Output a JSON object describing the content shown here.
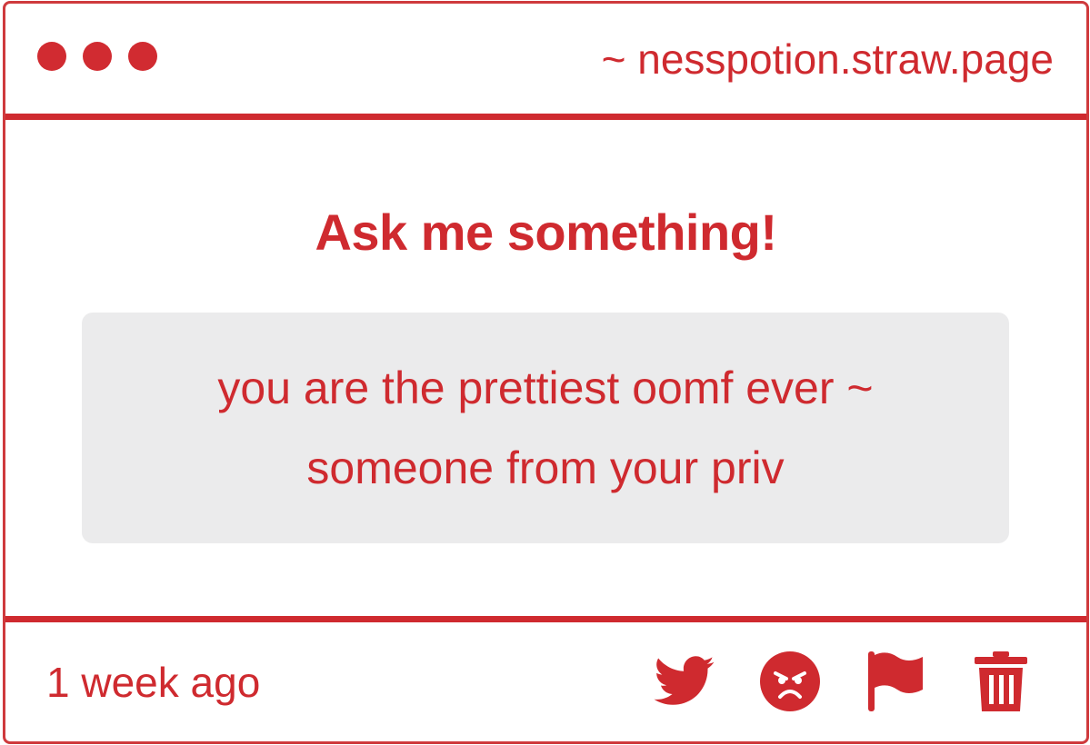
{
  "window": {
    "url": "~ nesspotion.straw.page",
    "dots": [
      "dot-1",
      "dot-2",
      "dot-3"
    ]
  },
  "main": {
    "heading": "Ask me something!",
    "message": "you are the prettiest oomf ever ~\nsomeone from your priv"
  },
  "footer": {
    "timestamp": "1 week ago",
    "actions": [
      {
        "icon": "twitter-icon"
      },
      {
        "icon": "angry-face-icon"
      },
      {
        "icon": "flag-icon"
      },
      {
        "icon": "trash-icon"
      }
    ]
  },
  "colors": {
    "accent": "#cf2a2f",
    "message_bg": "#ebebec",
    "background": "#ffffff"
  }
}
